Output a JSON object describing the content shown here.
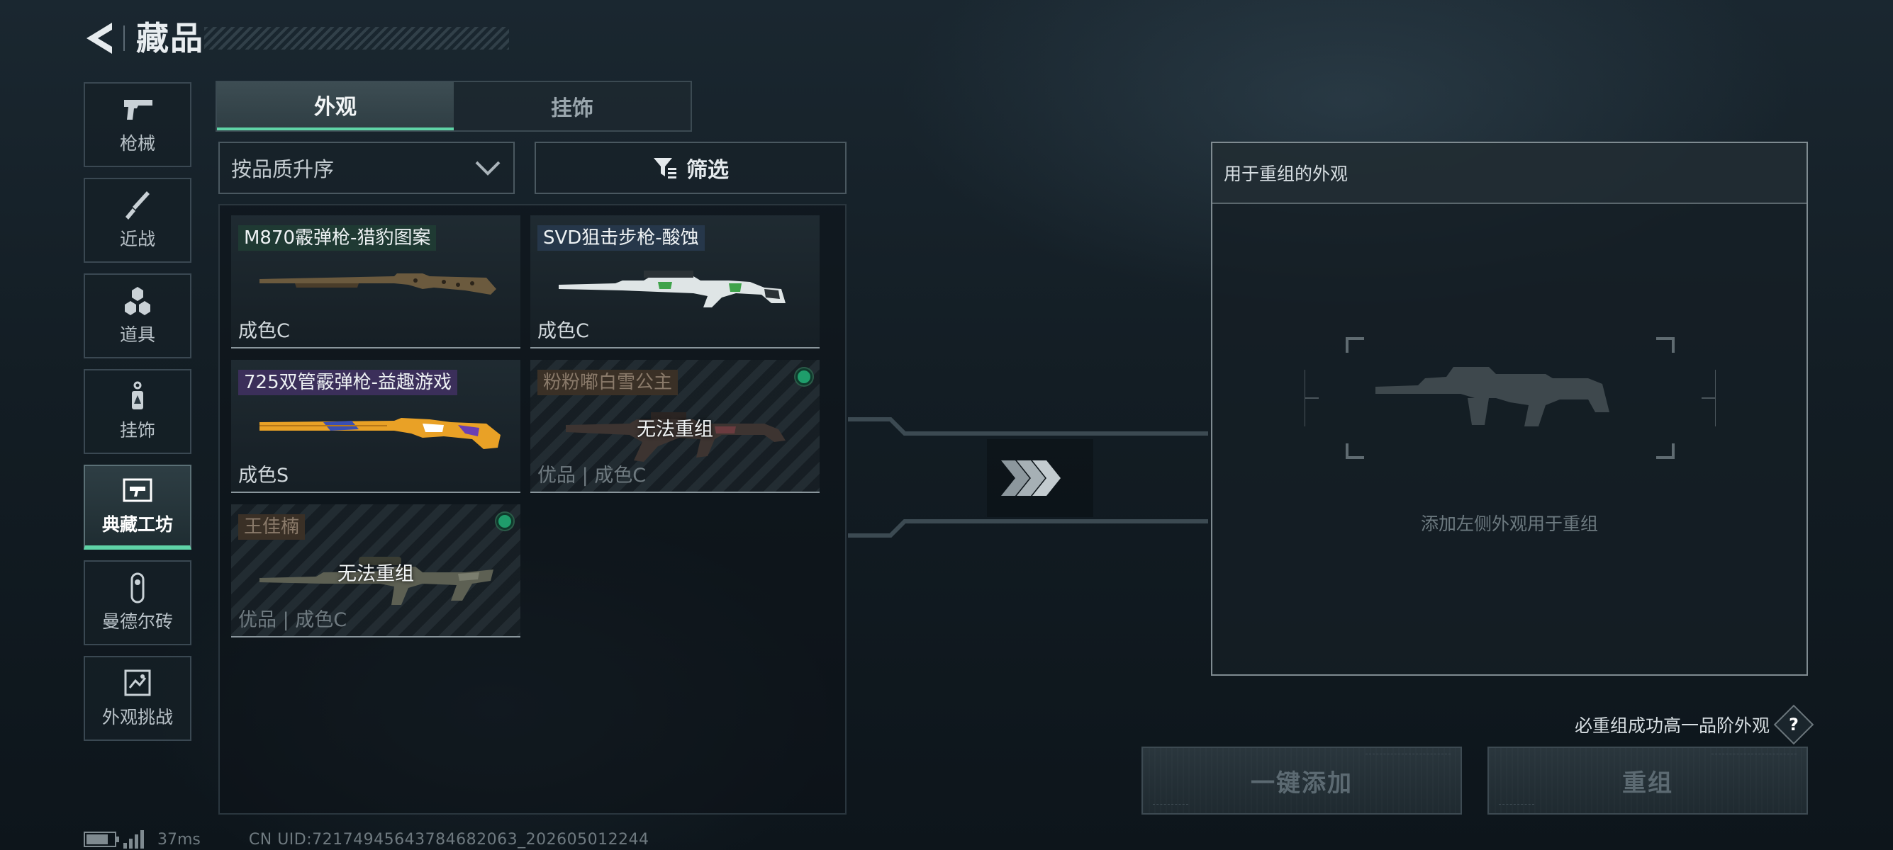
{
  "header": {
    "title": "藏品"
  },
  "sidebar": {
    "items": [
      {
        "label": "枪械",
        "icon": "pistol-icon",
        "active": false
      },
      {
        "label": "近战",
        "icon": "knife-icon",
        "active": false
      },
      {
        "label": "道具",
        "icon": "grenade-icon",
        "active": false
      },
      {
        "label": "挂饰",
        "icon": "charm-icon",
        "active": false
      },
      {
        "label": "典藏工坊",
        "icon": "workshop-icon",
        "active": true
      },
      {
        "label": "曼德尔砖",
        "icon": "mandel-brick-icon",
        "active": false
      },
      {
        "label": "外观挑战",
        "icon": "challenge-icon",
        "active": false
      }
    ]
  },
  "tabs": [
    {
      "label": "外观",
      "active": true
    },
    {
      "label": "挂饰",
      "active": false
    }
  ],
  "sort": {
    "label": "按品质升序"
  },
  "filter": {
    "label": "筛选"
  },
  "cards": [
    {
      "name": "M870霰弹枪-猎豹图案",
      "grade": "成色C",
      "locked": false,
      "tag_color": "#1f3a33",
      "gun": "shotgun-leopard"
    },
    {
      "name": "SVD狙击步枪-酸蚀",
      "grade": "成色C",
      "locked": false,
      "tag_color": "#26374a",
      "gun": "sniper-acid"
    },
    {
      "name": "725双管霰弹枪-益趣游戏",
      "grade": "成色S",
      "locked": false,
      "tag_color": "#3b2f5a",
      "gun": "double-barrel-fun"
    },
    {
      "name": "粉粉嘟白雪公主",
      "grade": "优品 | 成色C",
      "locked": true,
      "lock_text": "无法重组",
      "tag_color": "#3a3026",
      "gun": "assault-rifle-pink"
    },
    {
      "name": "王佳楠",
      "grade": "优品 | 成色C",
      "locked": true,
      "lock_text": "无法重组",
      "tag_color": "#3a3026",
      "gun": "rifle-wang"
    }
  ],
  "recomb_panel": {
    "title": "用于重组的外观",
    "hint": "添加左侧外观用于重组"
  },
  "guarantee": {
    "text": "必重组成功高一品阶外观",
    "help": "?"
  },
  "buttons": {
    "add_all": "一键添加",
    "recombine": "重组"
  },
  "footer": {
    "ping": "37ms",
    "uid": "CN UID:72174945643784682063_202605012244",
    "battery_level": 0.8
  },
  "colors": {
    "accent": "#5fd3a6",
    "status_dot": "#1f9d6b"
  }
}
